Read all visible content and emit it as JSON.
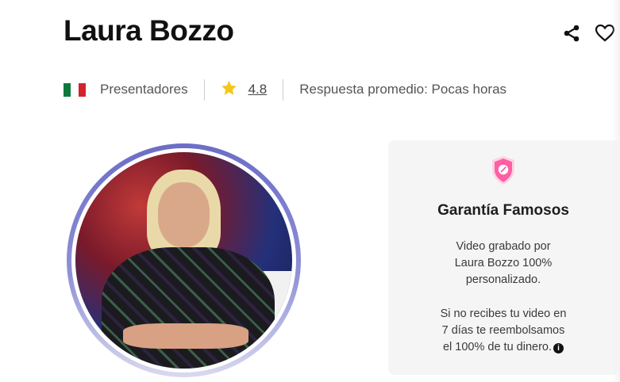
{
  "profile": {
    "name": "Laura Bozzo",
    "category": "Presentadores",
    "rating": "4.8",
    "response": "Respuesta promedio: Pocas horas",
    "country_flag": "mexico-flag-icon"
  },
  "icons": {
    "share": "share-icon",
    "favorite": "heart-icon",
    "star": "star-icon",
    "shield": "shield-icon",
    "info": "info-icon"
  },
  "colors": {
    "star": "#f5c518",
    "shield": "#ff5fa2",
    "ring": "#6b6dc7"
  },
  "guarantee": {
    "title": "Garantía Famosos",
    "line1": "Video grabado por",
    "line2": "Laura Bozzo 100%",
    "line3": "personalizado.",
    "line4": "Si no recibes tu video en",
    "line5": "7 días te reembolsamos",
    "line6": "el 100% de tu dinero."
  }
}
